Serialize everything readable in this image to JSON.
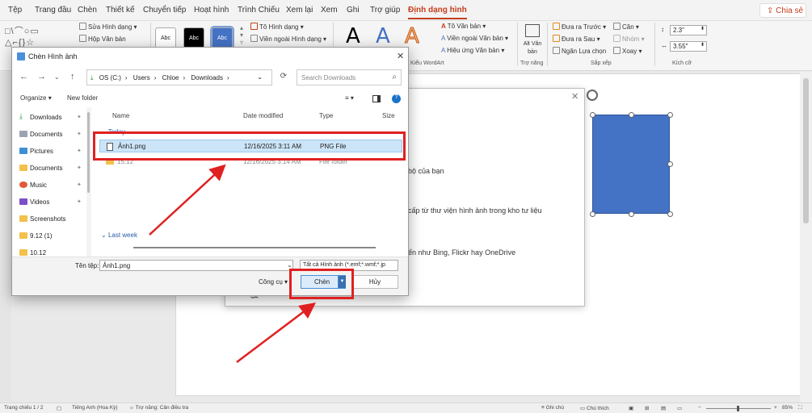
{
  "menu": {
    "tabs": [
      "Tệp",
      "Trang đầu",
      "Chèn",
      "Thiết kế",
      "Chuyển tiếp",
      "Hoạt hình",
      "Trình Chiếu",
      "Xem lại",
      "Xem",
      "Ghi",
      "Trợ giúp",
      "Định dạng hình"
    ],
    "active_tab": "Định dạng hình",
    "share": "Chia sẻ"
  },
  "ribbon": {
    "edit_shape": "Sửa Hình dạng",
    "text_box": "Hộp Văn bản",
    "shape_style_samples": [
      "Abc",
      "Abc",
      "Abc"
    ],
    "shape_fill": "Tô Hình dạng",
    "shape_outline": "Viền ngoài Hình dạng",
    "wordart_letters": [
      "A",
      "A",
      "A"
    ],
    "text_fill": "Tô Văn bản",
    "text_outline": "Viền ngoài Văn bản",
    "text_effects": "Hiệu ứng Văn bản",
    "wordart_group": "Kiểu WordArt",
    "alt_text": "Alt Văn bản",
    "accessibility_group": "Trợ năng",
    "bring_forward": "Đưa ra Trước",
    "send_backward": "Đưa ra Sau",
    "selection_pane": "Ngăn Lựa chọn",
    "align": "Căn",
    "group": "Nhóm",
    "rotate": "Xoay",
    "arrange_group": "Sắp xếp",
    "height": "2.3\"",
    "width": "3.55\"",
    "size_group": "Kích cỡ"
  },
  "insert_panel": {
    "lines": [
      "bộ của bạn",
      "cấp từ thư viện hình ảnh trong kho tư liệu",
      "ến như Bing, Flickr hay OneDrive"
    ]
  },
  "dialog": {
    "title": "Chèn Hình ảnh",
    "path": [
      "OS (C:)",
      "Users",
      "Chloe",
      "Downloads"
    ],
    "search_placeholder": "Search Downloads",
    "organize": "Organize",
    "new_folder": "New folder",
    "sidebar": [
      "Downloads",
      "Documents",
      "Pictures",
      "Documents",
      "Music",
      "Videos",
      "Screenshots",
      "9.12 (1)",
      "10.12"
    ],
    "columns": [
      "Name",
      "Date modified",
      "Type",
      "Size"
    ],
    "group_today": "Today",
    "group_last_week": "Last week",
    "files": [
      {
        "name": "Ảnh1.png",
        "date": "12/16/2025 3:11 AM",
        "type": "PNG File"
      },
      {
        "name": "15.12",
        "date": "12/16/2025 3:14 AM",
        "type": "File folder"
      }
    ],
    "filename_label": "Tên tệp:",
    "filename_value": "Ảnh1.png",
    "file_type": "Tất cả Hình ảnh (*.emf;*.wmf;*.jp",
    "tools": "Công cụ",
    "open": "Chèn",
    "cancel": "Hủy"
  },
  "statusbar": {
    "slide": "Trang chiếu 1 / 2",
    "language": "Tiếng Anh (Hoa Kỳ)",
    "accessibility": "Trợ năng: Cân điều tra",
    "notes": "Ghi chú",
    "comments": "Chú thích",
    "zoom": "85%"
  },
  "colors": {
    "accent": "#c43e1c",
    "shape": "#4472c4",
    "annotation": "#e02020"
  }
}
